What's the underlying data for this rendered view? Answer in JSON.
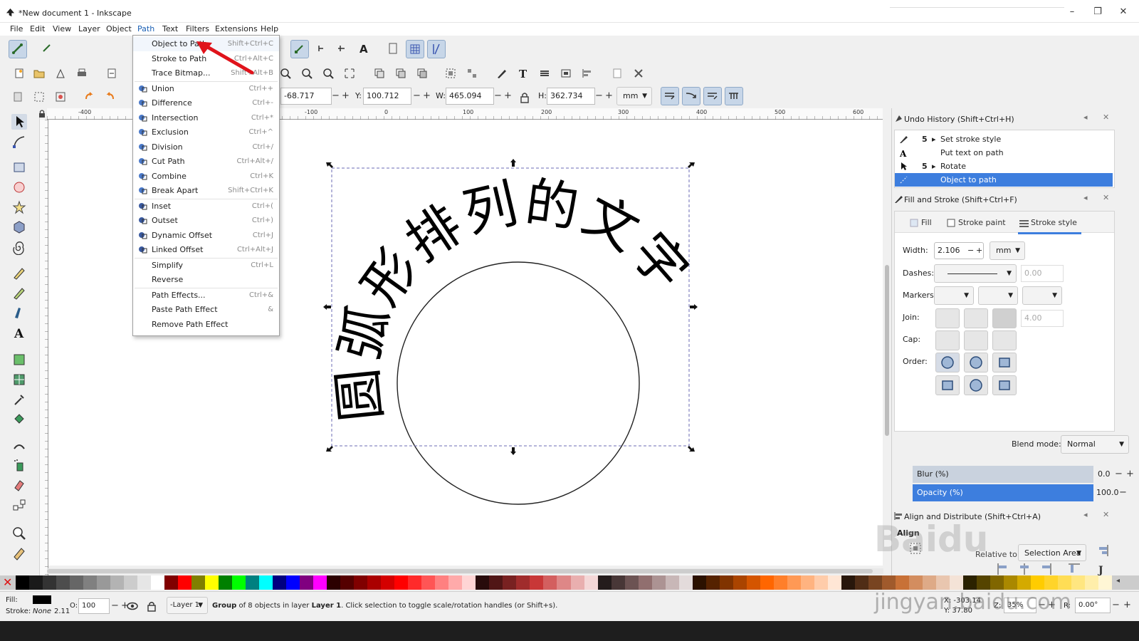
{
  "window": {
    "title": "*New document 1 - Inkscape",
    "controls": [
      "–",
      "❐",
      "✕"
    ]
  },
  "menubar": [
    {
      "label": "File"
    },
    {
      "label": "Edit"
    },
    {
      "label": "View"
    },
    {
      "label": "Layer"
    },
    {
      "label": "Object"
    },
    {
      "label": "Path"
    },
    {
      "label": "Text"
    },
    {
      "label": "Filters"
    },
    {
      "label": "Extensions"
    },
    {
      "label": "Help"
    }
  ],
  "path_menu": {
    "items": [
      {
        "label": "Object to Path",
        "shortcut": "Shift+Ctrl+C",
        "icon": "none"
      },
      {
        "label": "Stroke to Path",
        "shortcut": "Ctrl+Alt+C",
        "icon": "none"
      },
      {
        "label": "Trace Bitmap...",
        "shortcut": "Shift+Alt+B",
        "icon": "none"
      },
      {
        "label": "Union",
        "shortcut": "Ctrl++",
        "icon": "union-icon"
      },
      {
        "label": "Difference",
        "shortcut": "Ctrl+-",
        "icon": "difference-icon"
      },
      {
        "label": "Intersection",
        "shortcut": "Ctrl+*",
        "icon": "intersection-icon"
      },
      {
        "label": "Exclusion",
        "shortcut": "Ctrl+^",
        "icon": "exclusion-icon"
      },
      {
        "label": "Division",
        "shortcut": "Ctrl+/",
        "icon": "division-icon"
      },
      {
        "label": "Cut Path",
        "shortcut": "Ctrl+Alt+/",
        "icon": "cut-path-icon"
      },
      {
        "label": "Combine",
        "shortcut": "Ctrl+K",
        "icon": "combine-icon"
      },
      {
        "label": "Break Apart",
        "shortcut": "Shift+Ctrl+K",
        "icon": "break-apart-icon"
      },
      {
        "label": "Inset",
        "shortcut": "Ctrl+(",
        "icon": "inset-icon"
      },
      {
        "label": "Outset",
        "shortcut": "Ctrl+)",
        "icon": "outset-icon"
      },
      {
        "label": "Dynamic Offset",
        "shortcut": "Ctrl+J",
        "icon": "dynamic-offset-icon"
      },
      {
        "label": "Linked Offset",
        "shortcut": "Ctrl+Alt+J",
        "icon": "linked-offset-icon"
      },
      {
        "label": "Simplify",
        "shortcut": "Ctrl+L",
        "icon": "none"
      },
      {
        "label": "Reverse",
        "shortcut": "",
        "icon": "none"
      },
      {
        "label": "Path Effects...",
        "shortcut": "Ctrl+&",
        "icon": "none"
      },
      {
        "label": "Paste Path Effect",
        "shortcut": "&",
        "icon": "none"
      },
      {
        "label": "Remove Path Effect",
        "shortcut": "",
        "icon": "none"
      }
    ]
  },
  "toolbar": {
    "x_label": "X:",
    "x_value": "-68.717",
    "y_label": "Y:",
    "y_value": "100.712",
    "w_label": "W:",
    "w_value": "465.094",
    "h_label": "H:",
    "h_value": "362.734",
    "unit": "mm"
  },
  "ruler": {
    "ticks": [
      "-400",
      "-100",
      "0",
      "100",
      "200",
      "300",
      "400",
      "500",
      "600"
    ]
  },
  "canvas": {
    "arc_text": "圆弧形排列的文字",
    "accent_red": "#e0131b"
  },
  "undo_history": {
    "title": "Undo History (Shift+Ctrl+H)",
    "rows": [
      {
        "count": "5",
        "label": "Set stroke style"
      },
      {
        "count": "",
        "label": "Put text on path"
      },
      {
        "count": "5",
        "label": "Rotate"
      },
      {
        "count": "",
        "label": "Object to path"
      }
    ]
  },
  "fill_stroke": {
    "title": "Fill and Stroke (Shift+Ctrl+F)",
    "tabs": [
      "Fill",
      "Stroke paint",
      "Stroke style"
    ],
    "width_label": "Width:",
    "width_value": "2.106",
    "width_unit": "mm",
    "dashes_label": "Dashes:",
    "dashes_value": "0.00",
    "markers_label": "Markers:",
    "join_label": "Join:",
    "join_value": "4.00",
    "cap_label": "Cap:",
    "order_label": "Order:",
    "blend_label": "Blend mode:",
    "blend_value": "Normal",
    "blur_label": "Blur (%)",
    "blur_value": "0.0",
    "opacity_label": "Opacity (%)",
    "opacity_value": "100.0",
    "accent": "#3d7ede"
  },
  "align": {
    "title": "Align and Distribute (Shift+Ctrl+A)",
    "heading": "Align",
    "relative_to": "Relative to:",
    "selection_area": "Selection Area"
  },
  "status": {
    "fill_label": "Fill:",
    "stroke_label": "Stroke:",
    "stroke_value": "None",
    "stroke_width": "2.11",
    "o_label": "O:",
    "o_value": "100",
    "layer": "-Layer 1",
    "message_bold": "Group",
    "message_rest": " of 8 objects in layer ",
    "message_layer": "Layer 1",
    "message_tail": ". Click selection to toggle scale/rotation handles (or Shift+s).",
    "x_coord": "X: -303.14",
    "y_coord": "Y: 37.80",
    "z_label": "Z:",
    "zoom": "35%",
    "r_label": "R:",
    "rotation": "0.00°"
  },
  "watermark": {
    "line1": "Baidu",
    "line2": "jingyan.baidu.com"
  }
}
